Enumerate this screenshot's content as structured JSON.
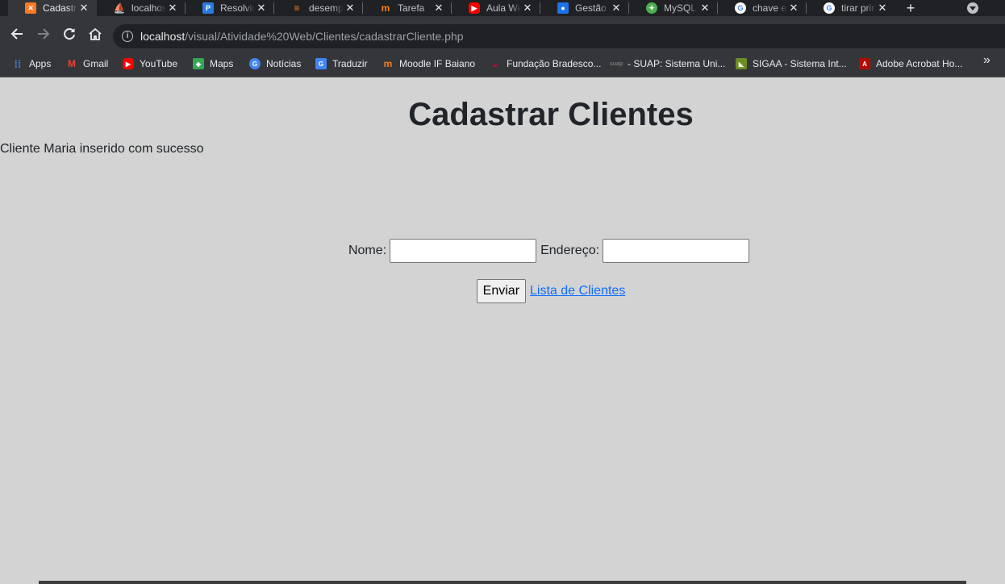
{
  "browser": {
    "tabs": [
      {
        "title": "Cadastrar",
        "icon": "xampp-icon",
        "color": "#fb7a24",
        "active": true
      },
      {
        "title": "localhost",
        "icon": "phpmyadmin-icon",
        "color": "#f89c0e",
        "active": false
      },
      {
        "title": "Resolvido",
        "icon": "pencil-logo-icon",
        "color": "#2a7ae2",
        "active": false
      },
      {
        "title": "desempenho",
        "icon": "stackoverflow-icon",
        "color": "#f48024",
        "active": false
      },
      {
        "title": "Tarefa",
        "icon": "moodle-icon",
        "color": "#f98012",
        "active": false
      },
      {
        "title": "Aula Web",
        "icon": "youtube-icon",
        "color": "#ff0000",
        "active": false
      },
      {
        "title": "Gestão de",
        "icon": "contacts-icon",
        "color": "#1a73e8",
        "active": false
      },
      {
        "title": "MySQL",
        "icon": "mysql-workbench-icon",
        "color": "#4caf50",
        "active": false
      },
      {
        "title": "chave es",
        "icon": "google-icon",
        "color": "#4285f4",
        "active": false
      },
      {
        "title": "tirar print",
        "icon": "google-icon",
        "color": "#4285f4",
        "active": false
      }
    ],
    "url": {
      "host": "localhost",
      "path": "/visual/Atividade%20Web/Clientes/cadastrarCliente.php"
    },
    "bookmarks": [
      {
        "label": "Apps",
        "icon": "apps-grid-icon",
        "color": "#4285f4"
      },
      {
        "label": "Gmail",
        "icon": "gmail-icon",
        "color": "#ea4335"
      },
      {
        "label": "YouTube",
        "icon": "youtube-icon",
        "color": "#ff0000"
      },
      {
        "label": "Maps",
        "icon": "maps-icon",
        "color": "#34a853"
      },
      {
        "label": "Notícias",
        "icon": "news-icon",
        "color": "#4285f4"
      },
      {
        "label": "Traduzir",
        "icon": "translate-icon",
        "color": "#4285f4"
      },
      {
        "label": "Moodle IF Baiano",
        "icon": "moodle-icon",
        "color": "#f98012"
      },
      {
        "label": "Fundação Bradesco...",
        "icon": "bradesco-icon",
        "color": "#cc092f"
      },
      {
        "label": "- SUAP: Sistema Uni...",
        "icon": "suap-icon",
        "color": "#3c3c3c"
      },
      {
        "label": "SIGAA - Sistema Int...",
        "icon": "sigaa-icon",
        "color": "#6b8e23"
      },
      {
        "label": "Adobe Acrobat Ho...",
        "icon": "acrobat-icon",
        "color": "#b30b00"
      }
    ]
  },
  "page": {
    "title": "Cadastrar Clientes",
    "message": "Cliente Maria inserido com sucesso",
    "form": {
      "nome_label": "Nome:",
      "endereco_label": "Endereço:",
      "nome_value": "",
      "endereco_value": "",
      "submit_label": "Enviar",
      "list_link": "Lista de Clientes"
    }
  }
}
